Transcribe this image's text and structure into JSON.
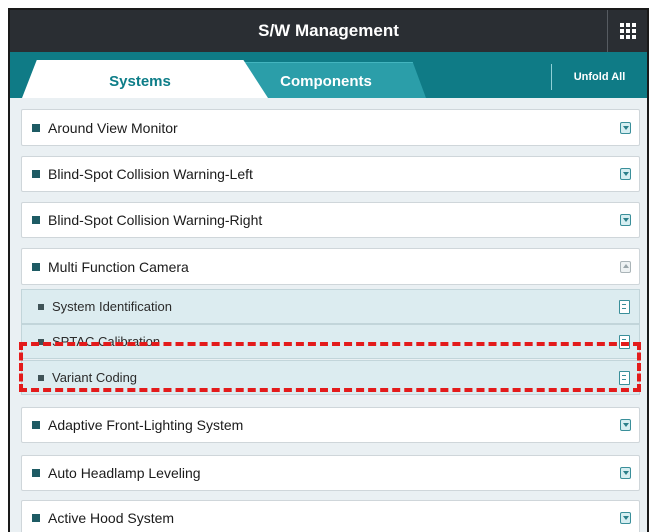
{
  "header": {
    "title": "S/W Management",
    "apps_icon": "grid-icon"
  },
  "tabs": [
    {
      "label": "Systems",
      "active": true
    },
    {
      "label": "Components",
      "active": false
    }
  ],
  "toolbar": {
    "unfold_label": "Unfold All"
  },
  "systems": [
    {
      "label": "Around View Monitor",
      "icon": "download-icon"
    },
    {
      "label": "Blind-Spot Collision Warning-Left",
      "icon": "download-icon"
    },
    {
      "label": "Blind-Spot Collision Warning-Right",
      "icon": "download-icon"
    },
    {
      "label": "Multi Function Camera",
      "icon": "upload-icon",
      "expanded": true
    },
    {
      "label": "Adaptive Front-Lighting System",
      "icon": "download-icon"
    },
    {
      "label": "Auto Headlamp Leveling",
      "icon": "download-icon"
    },
    {
      "label": "Active Hood System",
      "icon": "download-icon"
    }
  ],
  "sub_items": [
    {
      "label": "System Identification",
      "icon": "document-icon"
    },
    {
      "label": "SPTAC Calibration",
      "icon": "document-icon"
    },
    {
      "label": "Variant Coding",
      "icon": "document-icon",
      "highlighted": true
    }
  ],
  "colors": {
    "header_bg": "#2a2e33",
    "tab_bar": "#0f7b86",
    "accent_text": "#0d7d88",
    "highlight": "#e31b1b"
  }
}
